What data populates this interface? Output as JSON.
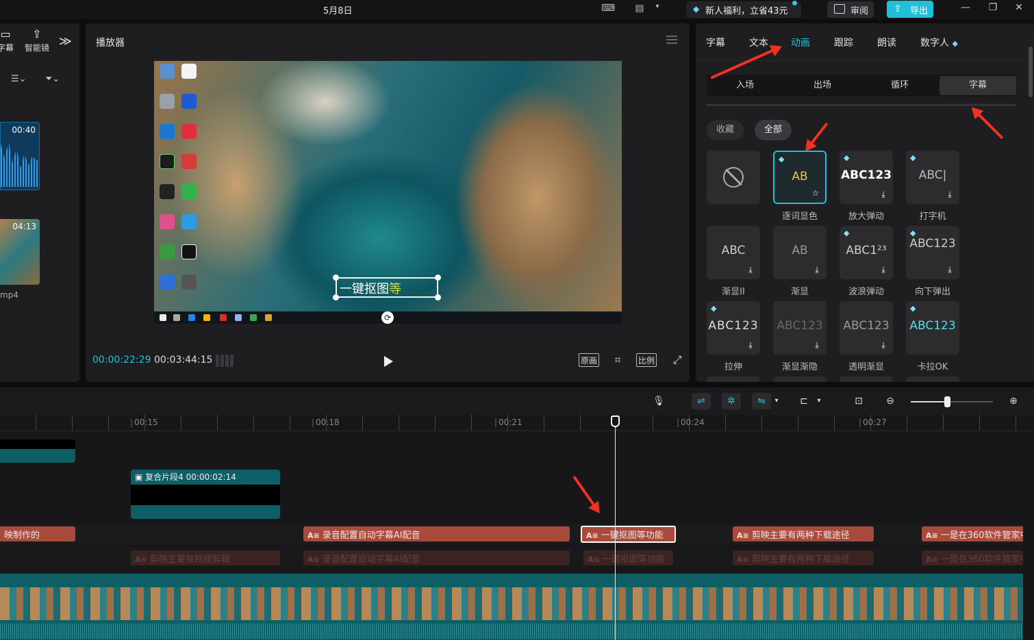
{
  "titlebar": {
    "date": "5月8日",
    "promo_label": "新人福利，立省43元",
    "review_label": "审阅",
    "export_label": "导出"
  },
  "left_panel": {
    "tabs": [
      {
        "label": "字幕",
        "icon": "caption-icon"
      },
      {
        "label": "智能镜",
        "icon": "magic-sparkle-icon"
      }
    ],
    "more_icon": "double-chevron-right-icon",
    "audio_thumb_duration": "00:40",
    "video_thumb_duration": "04:13",
    "video_filename": "mp4"
  },
  "player": {
    "title": "播放器",
    "current_time": "00:00:22:29",
    "total_time": "00:03:44:15",
    "caption_text_main": "一键抠图",
    "caption_text_highlight": "等",
    "controls": {
      "original_label": "原画",
      "ratio_label": "比例"
    }
  },
  "right_panel": {
    "tabs": [
      {
        "label": "字幕",
        "active": false
      },
      {
        "label": "文本",
        "active": false
      },
      {
        "label": "动画",
        "active": true
      },
      {
        "label": "跟踪",
        "active": false
      },
      {
        "label": "朗读",
        "active": false
      },
      {
        "label": "数字人",
        "active": false
      }
    ],
    "subtabs": [
      {
        "label": "入场",
        "active": false
      },
      {
        "label": "出场",
        "active": false
      },
      {
        "label": "循环",
        "active": false
      },
      {
        "label": "字幕",
        "active": true
      }
    ],
    "filters": [
      {
        "label": "收藏",
        "active": false
      },
      {
        "label": "全部",
        "active": true
      }
    ],
    "presets": [
      {
        "caption": "",
        "label": "",
        "premium": false,
        "selected": false,
        "icon": "none-icon"
      },
      {
        "caption": "AB",
        "label": "逐词显色",
        "premium": true,
        "selected": true,
        "icon": "star-icon"
      },
      {
        "caption": "ABC123",
        "label": "放大弹动",
        "premium": true,
        "selected": false,
        "icon": "download-icon"
      },
      {
        "caption": "ABC|",
        "label": "打字机",
        "premium": true,
        "selected": false,
        "icon": "download-icon"
      },
      {
        "caption": "ABC",
        "label": "渐显II",
        "premium": false,
        "selected": false,
        "icon": "download-icon"
      },
      {
        "caption": "AB",
        "label": "渐显",
        "premium": false,
        "selected": false,
        "icon": "download-icon"
      },
      {
        "caption": "ABC1²³",
        "label": "波浪弹动",
        "premium": true,
        "selected": false,
        "icon": "download-icon"
      },
      {
        "caption": "ABC123",
        "label": "向下弹出",
        "premium": true,
        "selected": false,
        "icon": "download-icon"
      },
      {
        "caption": "ABC123",
        "label": "拉伸",
        "premium": true,
        "selected": false,
        "icon": "download-icon"
      },
      {
        "caption": "ABC123",
        "label": "渐显渐隐",
        "premium": false,
        "selected": false,
        "icon": "download-icon"
      },
      {
        "caption": "ABC123",
        "label": "透明渐显",
        "premium": false,
        "selected": false,
        "icon": "download-icon"
      },
      {
        "caption": "ABC123",
        "label": "卡拉OK",
        "premium": true,
        "selected": false,
        "icon": "download-icon"
      }
    ]
  },
  "timeline": {
    "ruler_labels": [
      "00:15",
      "00:18",
      "00:21",
      "00:24",
      "00:27"
    ],
    "compound_clip": {
      "label": "复合片段4",
      "duration": "00:00:02:14"
    },
    "text_clips": [
      {
        "label": "映制作的"
      },
      {
        "label": "录音配置自动字幕AI配音"
      },
      {
        "label": "一键抠图等功能"
      },
      {
        "label": "剪映主要有两种下载途径"
      },
      {
        "label": "一是在360软件管家中"
      }
    ],
    "ghost_clips": [
      {
        "label": "剪映主要有视频剪辑"
      },
      {
        "label": "录音配置自动字幕AI配音"
      },
      {
        "label": "一键抠图等功能"
      },
      {
        "label": "剪映主要有两种下载途径"
      },
      {
        "label": "一是在360软件管家中"
      }
    ],
    "zoom_level": 0.45
  },
  "colors": {
    "accent": "#22c0d8",
    "text_clip": "#a84a3c",
    "video_clip": "#0e5e66",
    "annotation": "#ee3322"
  }
}
